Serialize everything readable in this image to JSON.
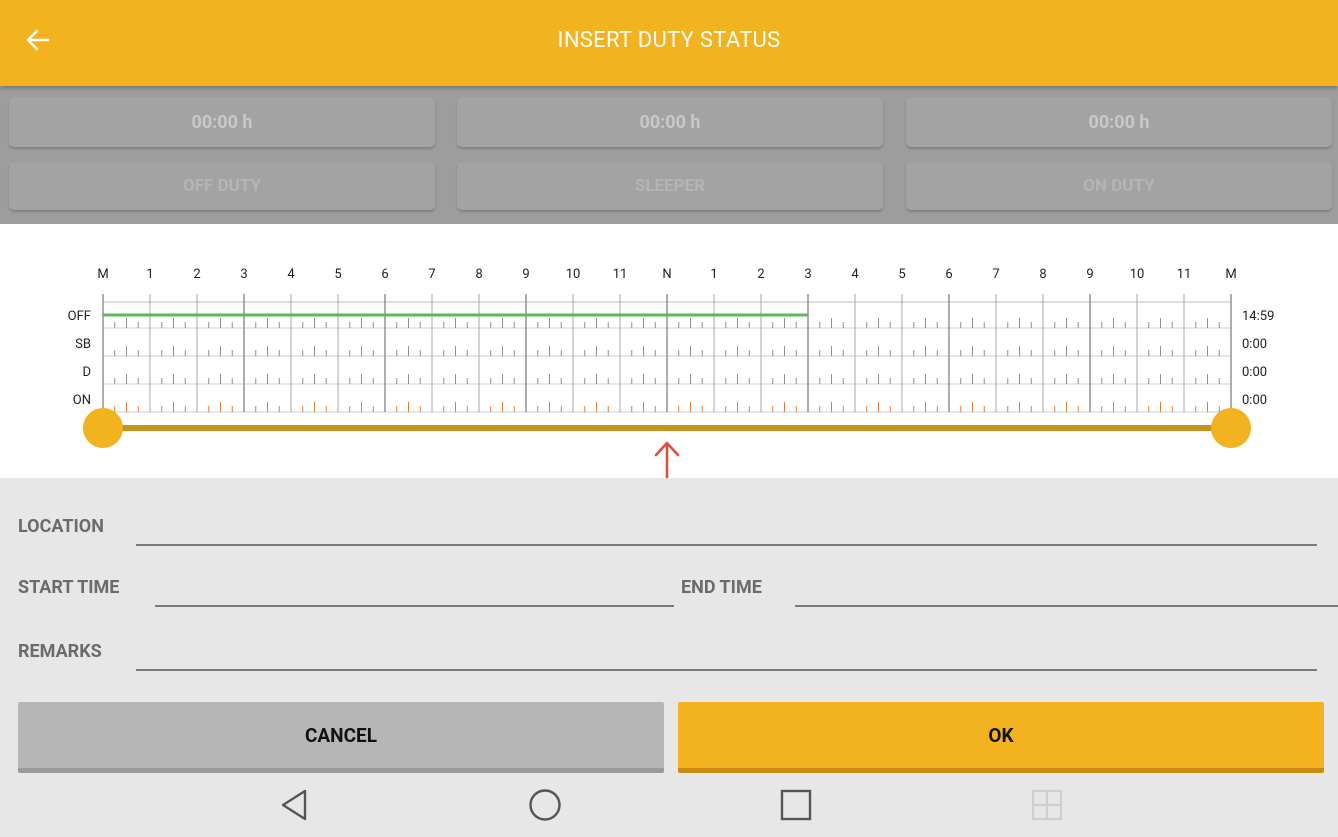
{
  "appbar": {
    "title": "INSERT DUTY STATUS",
    "back_icon": "arrow-left-icon"
  },
  "counters": [
    {
      "time": "00:00 h",
      "label": "OFF DUTY"
    },
    {
      "time": "00:00 h",
      "label": "SLEEPER"
    },
    {
      "time": "00:00 h",
      "label": "ON DUTY"
    }
  ],
  "chart": {
    "hour_labels": [
      "M",
      "1",
      "2",
      "3",
      "4",
      "5",
      "6",
      "7",
      "8",
      "9",
      "10",
      "11",
      "N",
      "1",
      "2",
      "3",
      "4",
      "5",
      "6",
      "7",
      "8",
      "9",
      "10",
      "11",
      "M"
    ],
    "rows": [
      {
        "label": "OFF",
        "total": "14:59"
      },
      {
        "label": "SB",
        "total": "0:00"
      },
      {
        "label": "D",
        "total": "0:00"
      },
      {
        "label": "ON",
        "total": "0:00"
      }
    ],
    "off_duty_end_hour": 15,
    "slider_start_hour": 0,
    "slider_end_hour": 24,
    "marker_hour": 12
  },
  "form": {
    "location_label": "LOCATION",
    "start_time_label": "START TIME",
    "end_time_label": "END TIME",
    "remarks_label": "REMARKS",
    "location_value": "",
    "start_time_value": "",
    "end_time_value": "",
    "remarks_value": ""
  },
  "actions": {
    "cancel_label": "CANCEL",
    "ok_label": "OK"
  },
  "navbar": {
    "icons": [
      "back-triangle-icon",
      "home-circle-icon",
      "recents-square-icon",
      "grid-icon"
    ]
  },
  "colors": {
    "accent": "#f2b31f",
    "off_line": "#5cb85c",
    "on_row_ticks": "#e07b39",
    "marker": "#e04e3e"
  }
}
